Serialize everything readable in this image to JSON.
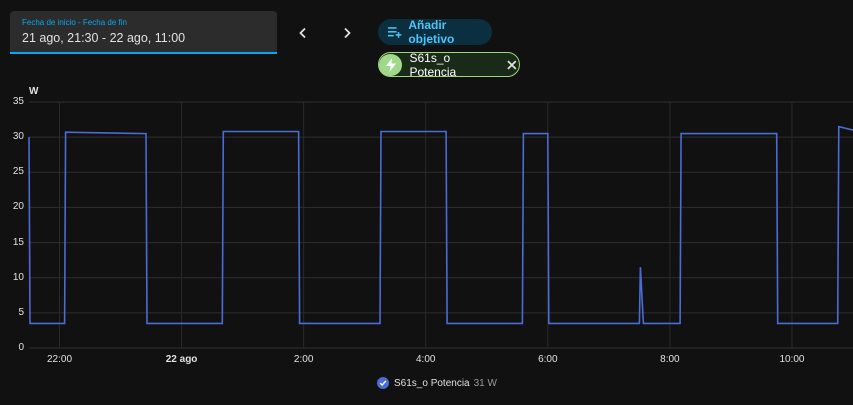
{
  "date_range": {
    "label": "Fecha de inicio - Fecha de fin",
    "value": "21 ago, 21:30 - 22 ago, 11:00"
  },
  "nav": {
    "prev_icon": "chevron-left-icon",
    "next_icon": "chevron-right-icon"
  },
  "add_target": {
    "label": "Añadir objetivo",
    "icon": "playlist-plus-icon"
  },
  "target_chip": {
    "label": "S61s_o Potencia",
    "icon": "lightning-bolt-icon",
    "color": "#9cd67f"
  },
  "legend": {
    "label": "S61s_o Potencia",
    "current": "31 W",
    "color": "#4a6cd4"
  },
  "chart_data": {
    "type": "line",
    "ylabel": "W",
    "yticks": [
      "0",
      "5",
      "10",
      "15",
      "20",
      "25",
      "30",
      "35"
    ],
    "ylim": [
      0,
      35
    ],
    "xticks": [
      "22:00",
      "22 ago",
      "2:00",
      "4:00",
      "6:00",
      "8:00",
      "10:00"
    ],
    "xlim": [
      "21 ago 21:30",
      "22 ago 11:00"
    ],
    "grid": true,
    "series": [
      {
        "name": "S61s_o Potencia",
        "color": "#4a6cd4",
        "x": [
          "21:30",
          "21:31",
          "22:05",
          "22:06",
          "23:25",
          "23:26",
          "00:40",
          "00:41",
          "01:55",
          "01:56",
          "03:15",
          "03:16",
          "04:20",
          "04:21",
          "05:35",
          "05:36",
          "06:00",
          "06:01",
          "07:30",
          "07:31",
          "07:34",
          "07:35",
          "07:36",
          "08:10",
          "08:11",
          "09:45",
          "09:46",
          "10:45",
          "10:46",
          "11:00"
        ],
        "y": [
          30,
          3.5,
          3.5,
          30.7,
          30.5,
          3.5,
          3.5,
          30.8,
          30.8,
          3.5,
          3.5,
          30.8,
          30.8,
          3.5,
          3.5,
          30.5,
          30.5,
          3.5,
          3.5,
          11.5,
          3.5,
          3.5,
          3.5,
          3.5,
          30.5,
          30.5,
          3.5,
          3.5,
          31.5,
          31
        ]
      }
    ]
  }
}
